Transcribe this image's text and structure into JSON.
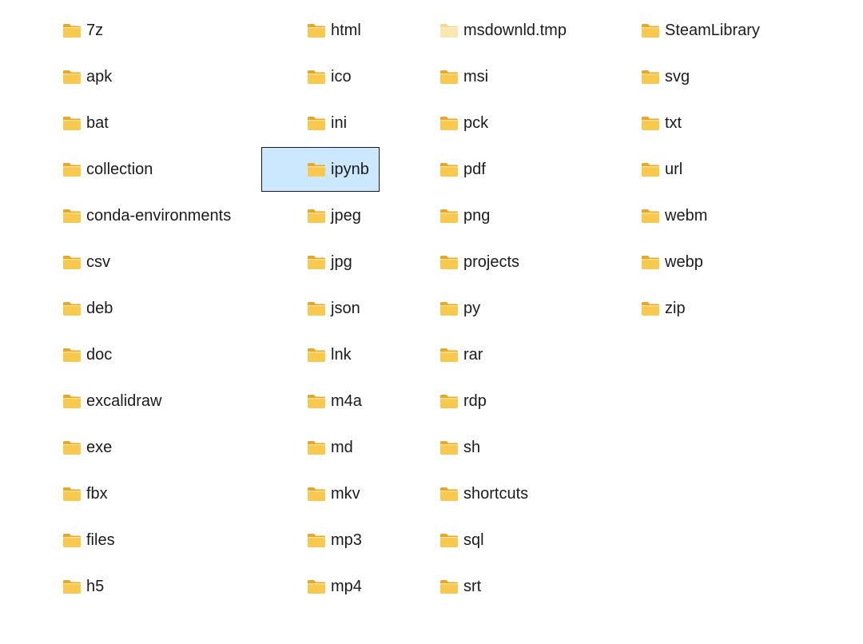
{
  "colors": {
    "selection_fill": "#cce8ff",
    "selection_border": "#1a1a1a",
    "folder_body": "#f8c94d",
    "folder_back": "#e6a82b",
    "folder_temp_body": "#fbe6b0",
    "folder_temp_back": "#f4d994",
    "text": "#1b1b1b"
  },
  "icon": "folder-icon",
  "columns": [
    {
      "items": [
        {
          "label": "7z"
        },
        {
          "label": "apk"
        },
        {
          "label": "bat"
        },
        {
          "label": "collection"
        },
        {
          "label": "conda-environments"
        },
        {
          "label": "csv"
        },
        {
          "label": "deb"
        },
        {
          "label": "doc"
        },
        {
          "label": "excalidraw"
        },
        {
          "label": "exe"
        },
        {
          "label": "fbx"
        },
        {
          "label": "files"
        },
        {
          "label": "h5"
        }
      ]
    },
    {
      "items": [
        {
          "label": "html"
        },
        {
          "label": "ico"
        },
        {
          "label": "ini"
        },
        {
          "label": "ipynb",
          "selected": true
        },
        {
          "label": "jpeg"
        },
        {
          "label": "jpg"
        },
        {
          "label": "json"
        },
        {
          "label": "lnk"
        },
        {
          "label": "m4a"
        },
        {
          "label": "md"
        },
        {
          "label": "mkv"
        },
        {
          "label": "mp3"
        },
        {
          "label": "mp4"
        }
      ]
    },
    {
      "items": [
        {
          "label": "msdownld.tmp",
          "faded": true
        },
        {
          "label": "msi"
        },
        {
          "label": "pck"
        },
        {
          "label": "pdf"
        },
        {
          "label": "png"
        },
        {
          "label": "projects"
        },
        {
          "label": "py"
        },
        {
          "label": "rar"
        },
        {
          "label": "rdp"
        },
        {
          "label": "sh"
        },
        {
          "label": "shortcuts"
        },
        {
          "label": "sql"
        },
        {
          "label": "srt"
        }
      ]
    },
    {
      "items": [
        {
          "label": "SteamLibrary"
        },
        {
          "label": "svg"
        },
        {
          "label": "txt"
        },
        {
          "label": "url"
        },
        {
          "label": "webm"
        },
        {
          "label": "webp"
        },
        {
          "label": "zip"
        }
      ]
    }
  ]
}
